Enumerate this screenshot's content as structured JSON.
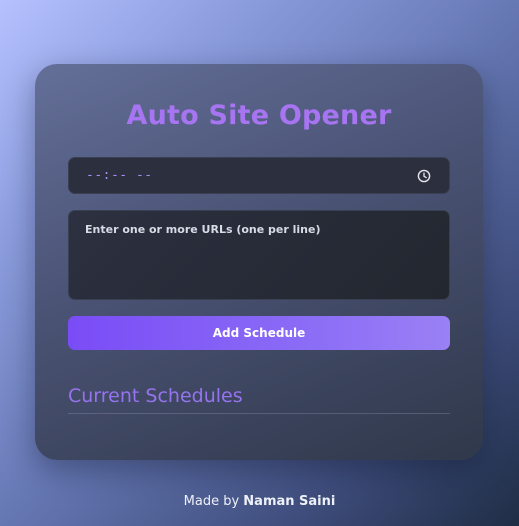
{
  "app": {
    "title": "Auto Site Opener"
  },
  "form": {
    "time_value": "--:-- --",
    "urls_placeholder": "Enter one or more URLs (one per line)",
    "add_button_label": "Add Schedule"
  },
  "schedules": {
    "heading": "Current Schedules",
    "items": []
  },
  "footer": {
    "prefix": "Made by ",
    "author": "Naman Saini"
  },
  "icons": {
    "time_picker": "clock-icon"
  },
  "colors": {
    "title": "#a774f2",
    "accent": "#7a4cf6",
    "section_heading": "#9673ef"
  }
}
